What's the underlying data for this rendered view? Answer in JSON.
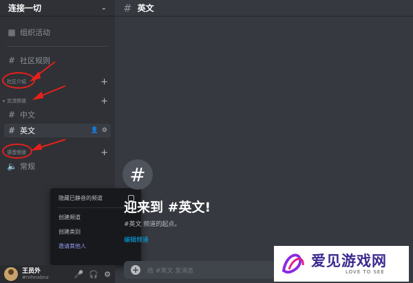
{
  "server": {
    "name": "连接一切",
    "chevron_icon": "chevron-down-icon"
  },
  "sidebar": {
    "events": {
      "icon": "calendar-icon",
      "label": "组织活动"
    },
    "rules": {
      "icon": "hash-icon",
      "label": "社区规则"
    },
    "categories": [
      {
        "label": "社区介绍"
      },
      {
        "label": "交流频道",
        "collapsed_caret": "⌄"
      },
      {
        "label": "语音频道"
      }
    ],
    "channels": {
      "chinese": {
        "label": "中文"
      },
      "english": {
        "label": "英文"
      },
      "voice": {
        "label": "常规"
      }
    }
  },
  "context_menu": {
    "items": [
      {
        "label": "隐藏已静音的频道"
      },
      {
        "label": "创建频道"
      },
      {
        "label": "创建类别"
      },
      {
        "label": "邀请其他人"
      }
    ]
  },
  "user": {
    "name": "王员外",
    "tag": "#nrhnxbnz"
  },
  "main": {
    "header_hash": "#",
    "header_title": "英文",
    "big_hash": "#",
    "welcome": "迎来到 #英文!",
    "sub": "#英文 频道的起点。",
    "edit_link": "编辑频道",
    "composer_placeholder": "给 #英文 发消息"
  },
  "watermark": {
    "text": "爱见游戏网",
    "sub": "LOVE TO SEE"
  },
  "colors": {
    "sidebar": "#2f3136",
    "main": "#36393f",
    "annotation_red": "#e8201a",
    "link": "#00aff4"
  }
}
